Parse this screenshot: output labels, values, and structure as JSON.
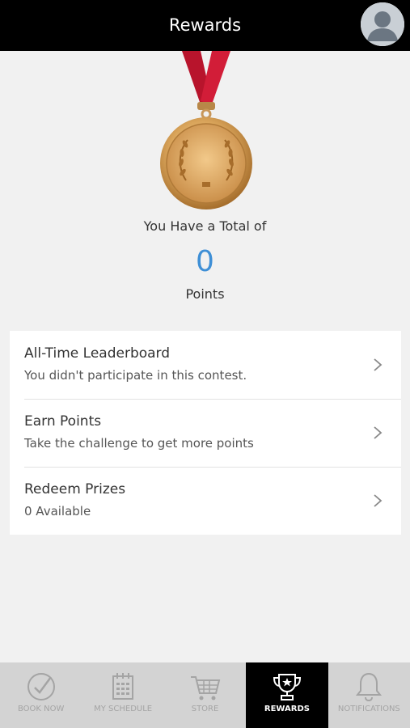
{
  "header": {
    "title": "Rewards"
  },
  "summary": {
    "total_label": "You Have a Total of",
    "points_value": "0",
    "points_label": "Points"
  },
  "list": {
    "items": [
      {
        "title": "All-Time Leaderboard",
        "subtitle": "You didn't participate in this contest."
      },
      {
        "title": "Earn Points",
        "subtitle": "Take the challenge to get more points"
      },
      {
        "title": "Redeem Prizes",
        "subtitle": "0 Available"
      }
    ]
  },
  "tabbar": {
    "tabs": [
      {
        "label": "BOOK NOW",
        "icon": "checkmark-circle-icon",
        "active": false
      },
      {
        "label": "MY SCHEDULE",
        "icon": "calendar-icon",
        "active": false
      },
      {
        "label": "STORE",
        "icon": "cart-icon",
        "active": false
      },
      {
        "label": "REWARDS",
        "icon": "trophy-icon",
        "active": true
      },
      {
        "label": "NOTIFICATIONS",
        "icon": "bell-icon",
        "active": false
      }
    ]
  },
  "colors": {
    "header_bg": "#000000",
    "accent_points": "#3e8fd6",
    "tabbar_bg": "#d3d3d3",
    "active_tab_bg": "#000000",
    "medal_ribbon": "#c0172f",
    "medal_gold": "#d9a45a"
  }
}
